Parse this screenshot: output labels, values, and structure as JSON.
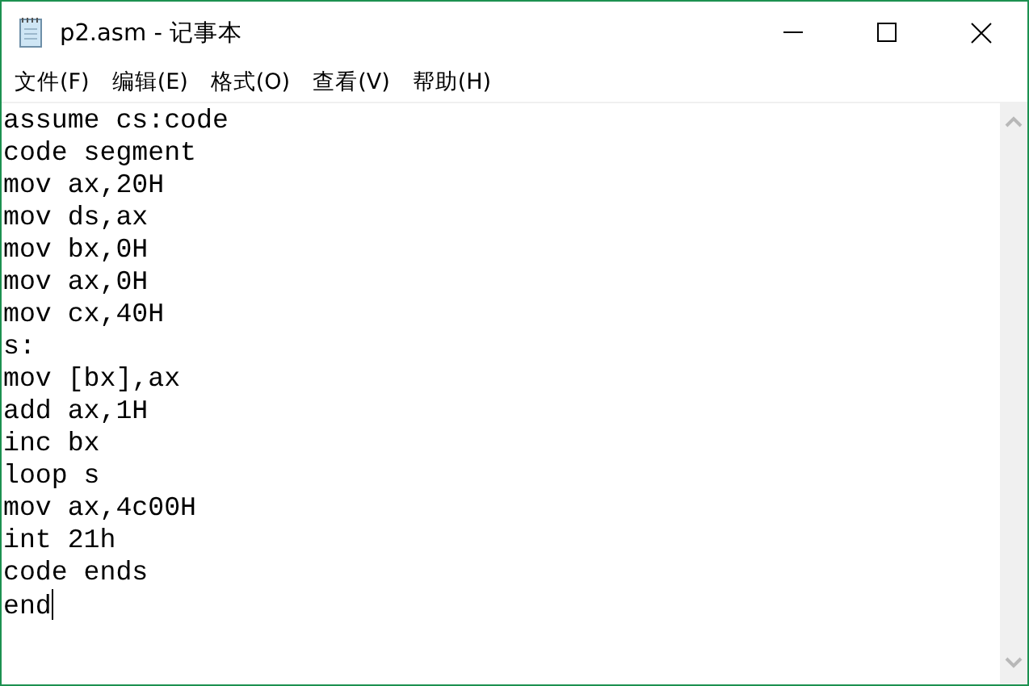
{
  "window": {
    "title": "p2.asm - 记事本"
  },
  "menu": [
    "文件(F)",
    "编辑(E)",
    "格式(O)",
    "查看(V)",
    "帮助(H)"
  ],
  "editor": {
    "lines": [
      "assume cs:code",
      "code segment",
      "mov ax,20H",
      "mov ds,ax",
      "mov bx,0H",
      "mov ax,0H",
      "mov cx,40H",
      "s:",
      "mov [bx],ax",
      "add ax,1H",
      "inc bx",
      "loop s",
      "mov ax,4c00H",
      "int 21h",
      "code ends",
      "end"
    ]
  }
}
